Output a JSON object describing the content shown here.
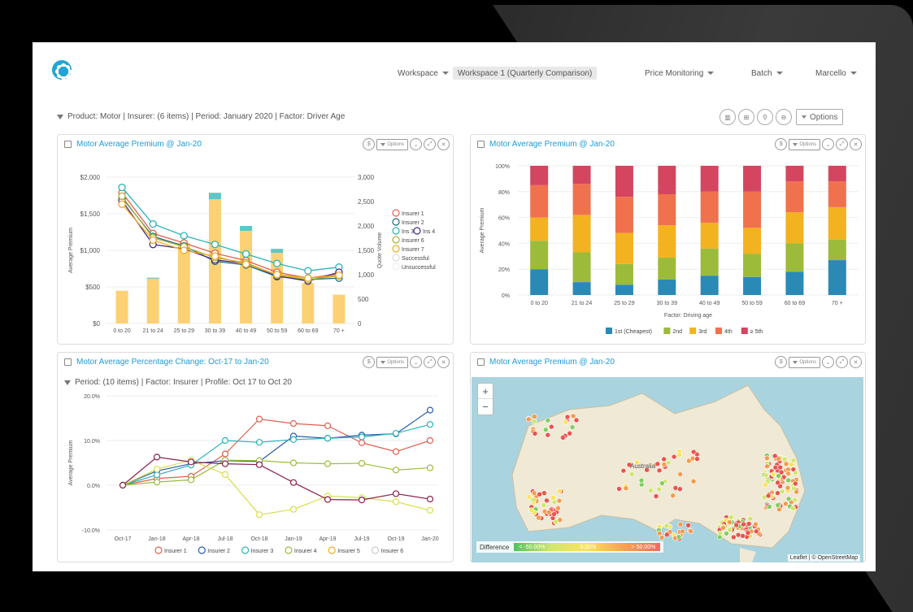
{
  "app": {
    "name": "finesse"
  },
  "header": {
    "workspace_label": "Workspace",
    "workspace_value": "Workspace 1 (Quarterly Comparison)",
    "price_monitoring": "Price Monitoring",
    "batch": "Batch",
    "user": "Marcello"
  },
  "filter": {
    "text": "Product: Motor | Insurer: (6 items) | Period: January 2020 | Factor: Driver Age",
    "options_label": "Options"
  },
  "panels": {
    "p1": {
      "title": "Motor Average Premium @ Jan-20",
      "options": "Options"
    },
    "p2": {
      "title": "Motor Average Premium @ Jan-20",
      "options": "Options"
    },
    "p3": {
      "title": "Motor Average Percentage Change: Oct-17 to Jan-20",
      "options": "Options",
      "subfilter": "Period: (10 items)  |  Factor: Insurer  |  Profile: Oct 17 to Oct 20"
    },
    "p4": {
      "title": "Motor Average Premium @ Jan-20",
      "options": "Options"
    }
  },
  "map": {
    "label": "Australia",
    "zoom_in": "+",
    "zoom_out": "−",
    "legend_title": "Difference",
    "legend_low": "< -50.00%",
    "legend_mid": "0.00%",
    "legend_high": "> 50.00%",
    "attribution": "Leaflet | © OpenStreetMap"
  },
  "chart_data": [
    {
      "type": "bar+line",
      "title": "",
      "ylabel": "Average Premium",
      "y2label": "Quote Volume",
      "categories": [
        "0 to 20",
        "21 to 24",
        "25 to 29",
        "30 to 39",
        "40 to 49",
        "50 to 59",
        "60 to 69",
        "70 +"
      ],
      "ylim": [
        0,
        2000
      ],
      "yticks": [
        "$0",
        "$500",
        "$1,000",
        "$1,500",
        "$2,000"
      ],
      "y2lim": [
        0,
        3000
      ],
      "y2ticks": [
        "0",
        "500",
        "1,000",
        "1,500",
        "2,000",
        "2,500",
        "3,000"
      ],
      "bars": {
        "successful": [
          670,
          920,
          1650,
          2550,
          1900,
          1450,
          830,
          590
        ],
        "unsuccessful": [
          0,
          20,
          0,
          130,
          100,
          80,
          0,
          0
        ]
      },
      "series": [
        {
          "name": "Insurer 1",
          "color": "#e0604f",
          "values": [
            1790,
            1230,
            1100,
            960,
            860,
            700,
            620,
            680
          ]
        },
        {
          "name": "Insurer 2",
          "color": "#1a6f80",
          "values": [
            1720,
            1190,
            1060,
            850,
            800,
            640,
            600,
            620
          ]
        },
        {
          "name": "Ins 3",
          "color": "#2bb3b8",
          "values": [
            1860,
            1360,
            1200,
            1080,
            950,
            820,
            720,
            770
          ]
        },
        {
          "name": "Ins 4",
          "color": "#4a2a82",
          "values": [
            1680,
            1080,
            1020,
            870,
            820,
            650,
            580,
            700
          ]
        },
        {
          "name": "Insurer 6",
          "color": "#aab23c",
          "values": [
            1740,
            1170,
            1050,
            900,
            830,
            660,
            600,
            650
          ]
        },
        {
          "name": "Insurer 7",
          "color": "#f2a922",
          "values": [
            1630,
            1140,
            1000,
            920,
            810,
            670,
            620,
            660
          ]
        }
      ],
      "legend": [
        "Insurer 1",
        "Insurer 2",
        "Ins 3",
        "Ins 4",
        "Insurer 6",
        "Insurer 7",
        "Successful",
        "Unsuccessful"
      ]
    },
    {
      "type": "stacked-bar",
      "title": "",
      "ylabel": "Average Premium",
      "xlabel": "Factor: Driving age",
      "categories": [
        "0 to 20",
        "21 to 24",
        "25 to 29",
        "30 to 39",
        "40 to 49",
        "50 to 59",
        "60 to 69",
        "70 +"
      ],
      "yticks": [
        "0%",
        "20%",
        "40%",
        "60%",
        "80%",
        "100%"
      ],
      "series": [
        {
          "name": "1st (Cheapest)",
          "color": "#2a8ab5",
          "values": [
            20,
            10,
            8,
            12,
            15,
            14,
            18,
            27
          ]
        },
        {
          "name": "2nd",
          "color": "#9cbb3a",
          "values": [
            22,
            23,
            16,
            17,
            21,
            18,
            22,
            16
          ]
        },
        {
          "name": "3rd",
          "color": "#f3b21f",
          "values": [
            18,
            29,
            24,
            25,
            20,
            20,
            24,
            25
          ]
        },
        {
          "name": "4th",
          "color": "#f0714e",
          "values": [
            25,
            24,
            28,
            24,
            24,
            28,
            24,
            20
          ]
        },
        {
          "name": "≥ 5th",
          "color": "#d44660",
          "values": [
            15,
            14,
            24,
            22,
            20,
            20,
            12,
            12
          ]
        }
      ]
    },
    {
      "type": "line",
      "title": "",
      "ylabel": "Average Premium",
      "categories": [
        "Oct-17",
        "Jan-18",
        "Apr-18",
        "Jul-18",
        "Oct-18",
        "Jan-19",
        "Apr-19",
        "Jul-19",
        "Oct-19",
        "Jan-20"
      ],
      "ylim": [
        -10,
        20
      ],
      "yticks": [
        "-10.0%",
        "0.0%",
        "10.0%",
        "20.0%"
      ],
      "series": [
        {
          "name": "Insurer 1",
          "color": "#e0604f",
          "values": [
            0,
            1.5,
            2,
            7,
            14.8,
            13.8,
            13.3,
            9.5,
            7.5,
            10
          ]
        },
        {
          "name": "Insurer 2",
          "color": "#2a5cab",
          "values": [
            0,
            3.2,
            4.8,
            5.5,
            5.3,
            11,
            10.5,
            11.2,
            11.5,
            16.8
          ]
        },
        {
          "name": "Insurer 3",
          "color": "#2bb3b8",
          "values": [
            0,
            2.3,
            4.5,
            10,
            9.6,
            10.2,
            10.5,
            10.8,
            11.6,
            13.6
          ]
        },
        {
          "name": "Insurer 4",
          "color": "#9cbb3a",
          "values": [
            0,
            0.7,
            1.2,
            5.6,
            5.5,
            5,
            4.8,
            4.9,
            3.4,
            3.9
          ]
        },
        {
          "name": "Insurer 5",
          "color": "#d9de4a",
          "values": [
            0,
            3.6,
            5.6,
            2.4,
            -6.6,
            -5.4,
            -2.4,
            -2.8,
            -3.7,
            -5.6
          ]
        },
        {
          "name": "Insurer 6",
          "color": "#8b1f4c",
          "values": [
            0,
            6.3,
            5.2,
            4.8,
            4.6,
            0.6,
            -3.2,
            -3.3,
            -1.9,
            -3.1
          ]
        }
      ],
      "legend": [
        "Insurer 1",
        "Insurer 2",
        "Insurer 3",
        "Insurer 4",
        "Insurer 5",
        "Insurer 6"
      ],
      "legend_colors": [
        "#e0604f",
        "#2a5cab",
        "#2bb3b8",
        "#9cbb3a",
        "#f2a922",
        "#cccccc"
      ]
    }
  ]
}
